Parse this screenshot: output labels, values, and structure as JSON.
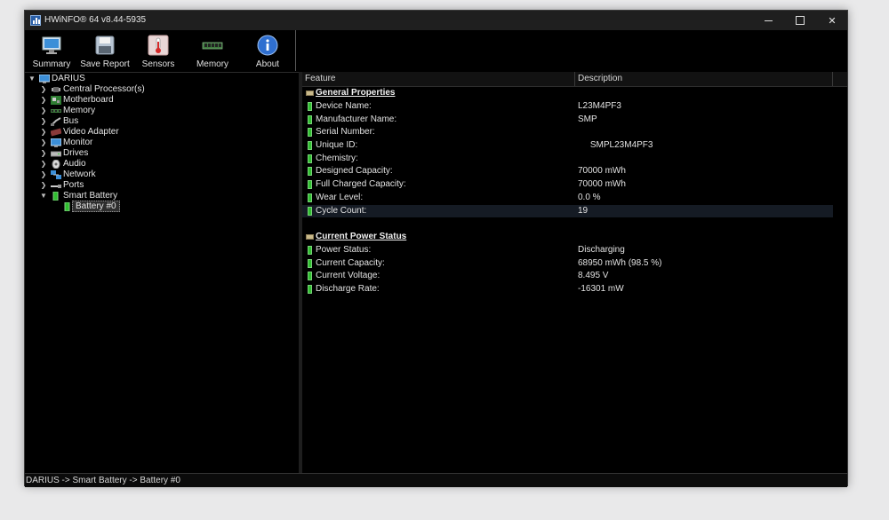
{
  "window": {
    "title": "HWiNFO® 64 v8.44-5935"
  },
  "toolbar": {
    "items": [
      {
        "label": "Summary",
        "icon": "monitor-icon"
      },
      {
        "label": "Save Report",
        "icon": "floppy-disk-icon"
      },
      {
        "label": "Sensors",
        "icon": "thermometer-icon"
      },
      {
        "label": "Memory",
        "icon": "memory-module-icon"
      },
      {
        "label": "About",
        "icon": "info-icon"
      }
    ]
  },
  "tree": {
    "root": "DARIUS",
    "items": [
      {
        "label": "Central Processor(s)",
        "icon": "cpu-icon"
      },
      {
        "label": "Motherboard",
        "icon": "motherboard-icon"
      },
      {
        "label": "Memory",
        "icon": "memory-icon"
      },
      {
        "label": "Bus",
        "icon": "bus-icon"
      },
      {
        "label": "Video Adapter",
        "icon": "video-adapter-icon"
      },
      {
        "label": "Monitor",
        "icon": "monitor-icon"
      },
      {
        "label": "Drives",
        "icon": "drive-icon"
      },
      {
        "label": "Audio",
        "icon": "speaker-icon"
      },
      {
        "label": "Network",
        "icon": "network-icon"
      },
      {
        "label": "Ports",
        "icon": "port-icon"
      },
      {
        "label": "Smart Battery",
        "icon": "battery-icon"
      }
    ],
    "child": "Battery #0"
  },
  "details": {
    "columns": [
      "Feature",
      "Description"
    ],
    "sections": [
      {
        "title": "General Properties",
        "rows": [
          {
            "feature": "Device Name:",
            "value": "L23M4PF3"
          },
          {
            "feature": "Manufacturer Name:",
            "value": "SMP"
          },
          {
            "feature": "Serial Number:",
            "value": ""
          },
          {
            "feature": "Unique ID:",
            "value": "     SMPL23M4PF3"
          },
          {
            "feature": "Chemistry:",
            "value": ""
          },
          {
            "feature": "Designed Capacity:",
            "value": "70000 mWh"
          },
          {
            "feature": "Full Charged Capacity:",
            "value": "70000 mWh"
          },
          {
            "feature": "Wear Level:",
            "value": "0.0 %"
          },
          {
            "feature": "Cycle Count:",
            "value": "19"
          }
        ]
      },
      {
        "title": "Current Power Status",
        "rows": [
          {
            "feature": "Power Status:",
            "value": "Discharging"
          },
          {
            "feature": "Current Capacity:",
            "value": "68950 mWh (98.5 %)"
          },
          {
            "feature": "Current Voltage:",
            "value": "8.495 V"
          },
          {
            "feature": "Discharge Rate:",
            "value": "-16301 mW"
          }
        ]
      }
    ]
  },
  "status": {
    "path": "DARIUS -> Smart Battery -> Battery #0"
  }
}
